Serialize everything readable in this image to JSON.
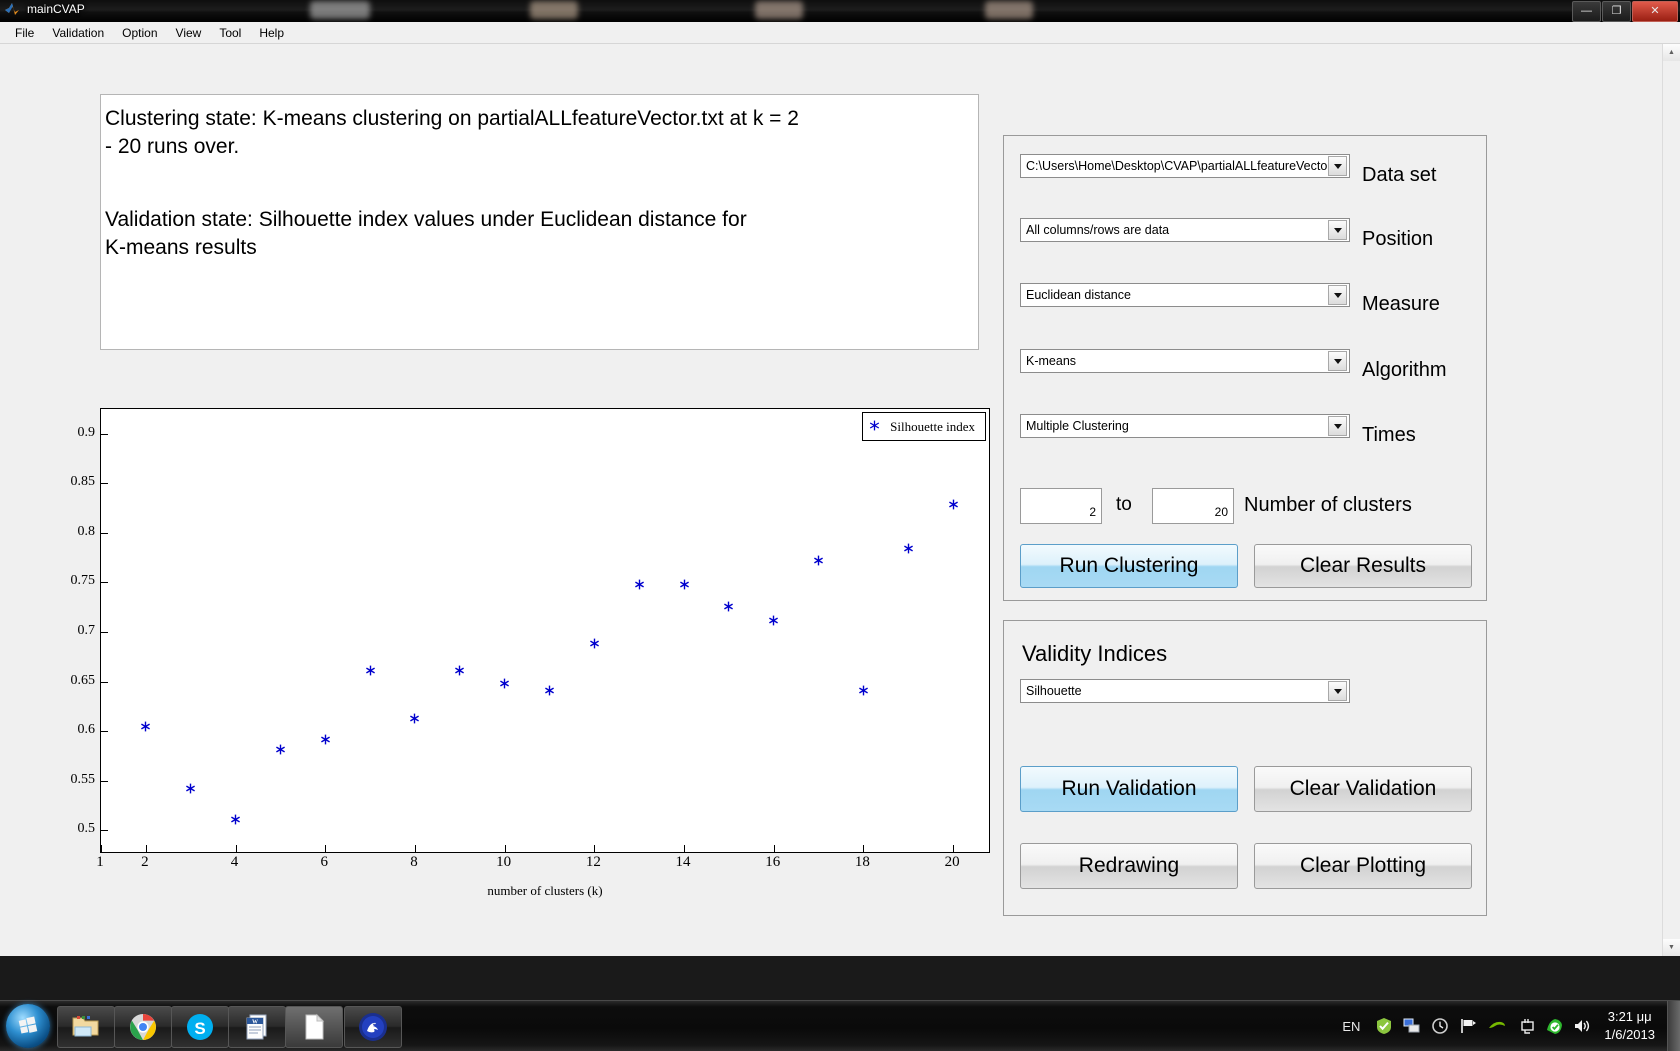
{
  "window": {
    "title": "mainCVAP",
    "buttons": {
      "minimize": "—",
      "maximize": "❐",
      "close": "✕"
    }
  },
  "menubar": {
    "items": [
      {
        "label": "File"
      },
      {
        "label": "Validation"
      },
      {
        "label": "Option"
      },
      {
        "label": "View"
      },
      {
        "label": "Tool"
      },
      {
        "label": "Help"
      }
    ]
  },
  "status_box": {
    "clustering_state_line1": "Clustering state: K-means clustering on  partialALLfeatureVector.txt at k = 2",
    "clustering_state_line2": "- 20 runs over.",
    "validation_state_line1": "Validation state: Silhouette index values under Euclidean distance for",
    "validation_state_line2": "K-means results"
  },
  "clustering_panel": {
    "dataset": {
      "value": "C:\\Users\\Home\\Desktop\\CVAP\\partialALLfeatureVecto...",
      "label": "Data set"
    },
    "position": {
      "value": "All columns/rows are data",
      "label": "Position"
    },
    "measure": {
      "value": "Euclidean distance",
      "label": "Measure"
    },
    "algorithm": {
      "value": "K-means",
      "label": "Algorithm"
    },
    "times": {
      "value": "Multiple Clustering",
      "label": "Times"
    },
    "clusters": {
      "from_value": "2",
      "to_text": "to",
      "to_value": "20",
      "label": "Number of clusters"
    },
    "run_button": "Run Clustering",
    "clear_button": "Clear Results"
  },
  "validity_panel": {
    "title": "Validity Indices",
    "index_select": {
      "value": "Silhouette"
    },
    "run_validation_button": "Run Validation",
    "clear_validation_button": "Clear Validation",
    "redrawing_button": "Redrawing",
    "clear_plotting_button": "Clear Plotting"
  },
  "chart_data": {
    "type": "scatter",
    "title": "",
    "xlabel": "number of clusters (k)",
    "ylabel": "",
    "xlim": [
      1,
      20.8
    ],
    "ylim": [
      0.478,
      0.925
    ],
    "xticks": [
      1,
      2,
      4,
      6,
      8,
      10,
      12,
      14,
      16,
      18,
      20
    ],
    "yticks": [
      0.5,
      0.55,
      0.6,
      0.65,
      0.7,
      0.75,
      0.8,
      0.85,
      0.9
    ],
    "grid": false,
    "legend": {
      "position": "top-right",
      "entries": [
        "Silhouette index"
      ]
    },
    "marker": {
      "symbol": "asterisk",
      "color": "#0000cd"
    },
    "series": [
      {
        "name": "Silhouette index",
        "x": [
          2,
          3,
          4,
          5,
          6,
          7,
          8,
          9,
          10,
          11,
          12,
          13,
          14,
          15,
          16,
          17,
          18,
          19,
          20
        ],
        "values": [
          0.605,
          0.542,
          0.511,
          0.581,
          0.592,
          0.661,
          0.613,
          0.661,
          0.648,
          0.641,
          0.688,
          0.748,
          0.748,
          0.726,
          0.712,
          0.772,
          0.641,
          0.784,
          0.829
        ]
      }
    ]
  },
  "taskbar": {
    "start": "start-orb",
    "apps": [
      {
        "name": "explorer"
      },
      {
        "name": "chrome"
      },
      {
        "name": "skype"
      },
      {
        "name": "word"
      },
      {
        "name": "document"
      },
      {
        "name": "bird-app"
      }
    ],
    "tray": {
      "language": "EN",
      "icons": [
        "shield-check",
        "network",
        "clock-history",
        "flag",
        "nvidia",
        "display",
        "green-check",
        "volume"
      ],
      "time": "3:21 μμ",
      "date": "1/6/2013"
    }
  }
}
